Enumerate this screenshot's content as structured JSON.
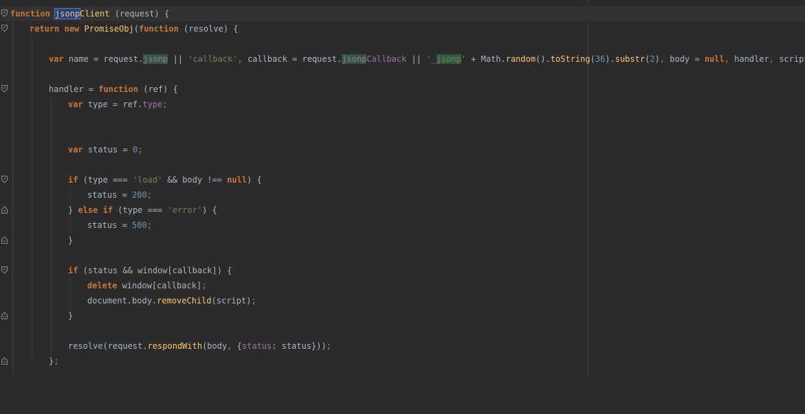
{
  "editor": {
    "lines": {
      "l1": {
        "kw_function": "function",
        "name_hl": "jsonp",
        "name_rest": "Client",
        "params": " (request) {"
      },
      "l2": {
        "kw_return": "return",
        "kw_new": "new",
        "ctor": "PromiseObj",
        "paren": "(",
        "kw_function": "function",
        "params": " (resolve) {"
      },
      "l3": {
        "kw_var": "var",
        "a1": " name = request.",
        "hl1": "jsonp",
        "a2": " || ",
        "s1": "'callback'",
        "c1": ",",
        "a3": " callback = request.",
        "hl2": "jsonp",
        "p1": "Callback",
        "a4": " || ",
        "s2a": "'_",
        "hl3": "jsonp",
        "s2b": "'",
        "a5": " + Math.",
        "f1": "random",
        "a6": "().",
        "f2": "toString",
        "a7": "(",
        "n1": "36",
        "a8": ").",
        "f3": "substr",
        "a9": "(",
        "n2": "2",
        "a10": ")",
        "c2": ",",
        "a11": " body = ",
        "kw_null": "null",
        "c3": ",",
        "a12": " handler",
        "c4": ",",
        "a13": " script",
        "c5": ";"
      },
      "l4": {
        "a1": "handler = ",
        "kw_function": "function",
        "a2": " (ref) {"
      },
      "l5": {
        "kw_var": "var",
        "a1": " type = ref.",
        "p1": "type",
        "c1": ";"
      },
      "l6": {
        "kw_var": "var",
        "a1": " status = ",
        "n1": "0",
        "c1": ";"
      },
      "l7": {
        "kw_if": "if",
        "a1": " (type === ",
        "s1": "'load'",
        "a2": " && body !== ",
        "kw_null": "null",
        "a3": ") {"
      },
      "l8": {
        "a1": "status = ",
        "n1": "200",
        "c1": ";"
      },
      "l9": {
        "a1": "} ",
        "kw_else": "else",
        "sp": " ",
        "kw_if": "if",
        "a2": " (type === ",
        "s1": "'error'",
        "a3": ") {"
      },
      "l10": {
        "a1": "status = ",
        "n1": "500",
        "c1": ";"
      },
      "l11": {
        "a1": "}"
      },
      "l12": {
        "kw_if": "if",
        "a1": " (status && window[callback]) {"
      },
      "l13": {
        "kw_delete": "delete",
        "a1": " window[callback]",
        "c1": ";"
      },
      "l14": {
        "a1": "document.body.",
        "f1": "removeChild",
        "a2": "(script)",
        "c1": ";"
      },
      "l15": {
        "a1": "}"
      },
      "l16": {
        "a1": "resolve(request.",
        "f1": "respondWith",
        "a2": "(body",
        "c1": ",",
        "a3": " {",
        "p1": "status",
        "a4": ": status}))",
        "c2": ";"
      },
      "l17": {
        "a1": "}",
        "c1": ";"
      }
    }
  },
  "colors": {
    "background": "#2b2b2b",
    "keyword": "#cc7832",
    "string": "#6a8759",
    "number": "#6897bb",
    "function": "#ffc66d",
    "property": "#9876aa",
    "text": "#a9b7c6",
    "match_highlight": "#32593d",
    "selection_highlight": "#214283"
  }
}
